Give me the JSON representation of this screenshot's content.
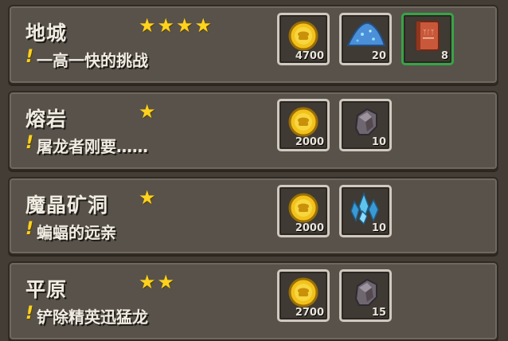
{
  "dungeons": [
    {
      "name": "地城",
      "stars": "★★★★",
      "description": "一高一快的挑战",
      "rewards": [
        {
          "icon": "gold-coin-icon",
          "quantity": "4700"
        },
        {
          "icon": "blue-sand-pile-icon",
          "quantity": "20"
        },
        {
          "icon": "red-tome-icon",
          "quantity": "8",
          "highlight": "#37a447"
        }
      ]
    },
    {
      "name": "熔岩",
      "stars": "★",
      "description": "屠龙者刚要……",
      "rewards": [
        {
          "icon": "gold-coin-icon",
          "quantity": "2000"
        },
        {
          "icon": "grey-ore-icon",
          "quantity": "10"
        }
      ]
    },
    {
      "name": "魔晶矿洞",
      "stars": "★",
      "description": "蝙蝠的远亲",
      "rewards": [
        {
          "icon": "gold-coin-icon",
          "quantity": "2000"
        },
        {
          "icon": "blue-crystal-icon",
          "quantity": "10"
        }
      ]
    },
    {
      "name": "平原",
      "stars": "★★",
      "description": "铲除精英迅猛龙",
      "rewards": [
        {
          "icon": "gold-coin-icon",
          "quantity": "2700"
        },
        {
          "icon": "grey-ore-icon",
          "quantity": "15"
        }
      ]
    }
  ]
}
